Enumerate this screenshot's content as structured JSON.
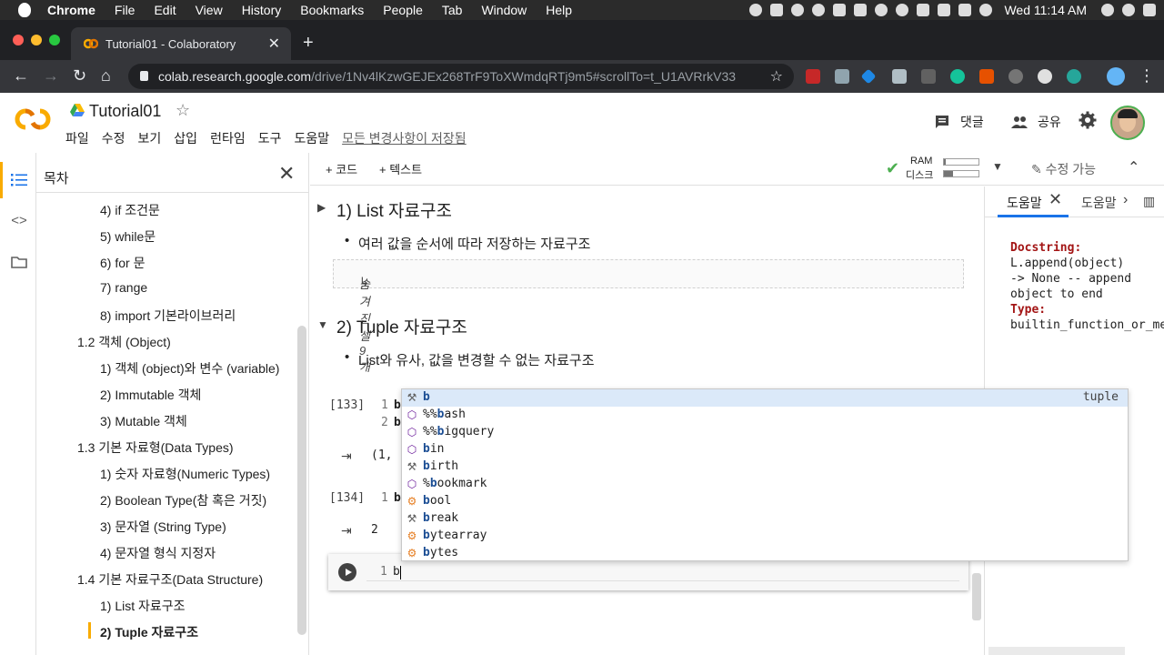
{
  "macos_menubar": {
    "app": "Chrome",
    "items": [
      "File",
      "Edit",
      "View",
      "History",
      "Bookmarks",
      "People",
      "Tab",
      "Window",
      "Help"
    ],
    "clock": "Wed 11:14 AM"
  },
  "browser": {
    "tab_title": "Tutorial01 - Colaboratory",
    "url_host": "colab.research.google.com",
    "url_path": "/drive/1Nv4lKzwGEJEx268TrF9ToXWmdqRTj9m5#scrollTo=t_U1AVRrkV33"
  },
  "colab": {
    "notebook_title": "Tutorial01",
    "menus": [
      "파일",
      "수정",
      "보기",
      "삽입",
      "런타임",
      "도구",
      "도움말"
    ],
    "save_status": "모든 변경사항이 저장됨",
    "comment_label": "댓글",
    "share_label": "공유"
  },
  "toc": {
    "title": "목차",
    "items": [
      {
        "label": "4) if 조건문",
        "level": 3
      },
      {
        "label": "5) while문",
        "level": 3
      },
      {
        "label": "6) for 문",
        "level": 3
      },
      {
        "label": "7) range",
        "level": 3
      },
      {
        "label": "8) import 기본라이브러리",
        "level": 3
      },
      {
        "label": "1.2 객체 (Object)",
        "level": 2
      },
      {
        "label": "1) 객체 (object)와 변수 (variable)",
        "level": 3
      },
      {
        "label": "2) Immutable 객체",
        "level": 3
      },
      {
        "label": "3) Mutable 객체",
        "level": 3
      },
      {
        "label": "1.3 기본 자료형(Data Types)",
        "level": 2
      },
      {
        "label": "1) 숫자 자료형(Numeric Types)",
        "level": 3
      },
      {
        "label": "2) Boolean Type(참 혹은 거짓)",
        "level": 3
      },
      {
        "label": "3) 문자열 (String Type)",
        "level": 3
      },
      {
        "label": "4) 문자열 형식 지정자",
        "level": 3
      },
      {
        "label": "1.4 기본 자료구조(Data Structure)",
        "level": 2
      },
      {
        "label": "1) List 자료구조",
        "level": 3
      },
      {
        "label": "2) Tuple 자료구조",
        "level": 3,
        "current": true
      }
    ]
  },
  "toolbar": {
    "add_code": "+ 코드",
    "add_text": "+ 텍스트",
    "ram_label": "RAM",
    "disk_label": "디스크",
    "ram_usage": 0.05,
    "disk_usage": 0.25,
    "edit_mode": "수정 가능"
  },
  "notebook": {
    "section1_title": "1) List 자료구조",
    "section1_bullet": "여러 값을 순서에 따라 저장하는 자료구조",
    "hidden_cells": "숨겨진 셀 9개",
    "section2_title": "2) Tuple 자료구조",
    "section2_bullet": "List와 유사, 값을 변경할 수 없는 자료구조",
    "cell133_exec": "[133]",
    "cell133_line1_no": "1",
    "cell133_line1": "b",
    "cell133_line2_no": "2",
    "cell133_line2": "b",
    "cell133_output": "(1,",
    "cell134_exec": "[134]",
    "cell134_line1_no": "1",
    "cell134_line1": "b",
    "cell134_output": "2",
    "active_line_no": "1",
    "active_code": "b"
  },
  "help_panel": {
    "tab1": "도움말",
    "tab2": "도움말",
    "docstring_label": "Docstring:",
    "docstring_lines": [
      "L.append(object)",
      "-> None -- append",
      "object to end"
    ],
    "type_label": "Type:",
    "type_value": "builtin_function_or_method"
  },
  "autocomplete": {
    "items": [
      {
        "prefix": "",
        "match": "b",
        "rest": "",
        "kind": "wrench",
        "type": "tuple",
        "selected": true
      },
      {
        "prefix": "%%",
        "match": "b",
        "rest": "ash",
        "kind": "cube",
        "type": ""
      },
      {
        "prefix": "%%",
        "match": "b",
        "rest": "igquery",
        "kind": "cube",
        "type": ""
      },
      {
        "prefix": "",
        "match": "b",
        "rest": "in",
        "kind": "cube",
        "type": ""
      },
      {
        "prefix": "",
        "match": "b",
        "rest": "irth",
        "kind": "wrench",
        "type": ""
      },
      {
        "prefix": "%",
        "match": "b",
        "rest": "ookmark",
        "kind": "cube",
        "type": ""
      },
      {
        "prefix": "",
        "match": "b",
        "rest": "ool",
        "kind": "class",
        "type": ""
      },
      {
        "prefix": "",
        "match": "b",
        "rest": "reak",
        "kind": "wrench",
        "type": ""
      },
      {
        "prefix": "",
        "match": "b",
        "rest": "ytearray",
        "kind": "class",
        "type": ""
      },
      {
        "prefix": "",
        "match": "b",
        "rest": "ytes",
        "kind": "class",
        "type": ""
      }
    ]
  },
  "colors": {
    "colab_orange": "#f9ab00",
    "selected_row": "#dbe9f9",
    "docstring_key": "#a31515"
  }
}
